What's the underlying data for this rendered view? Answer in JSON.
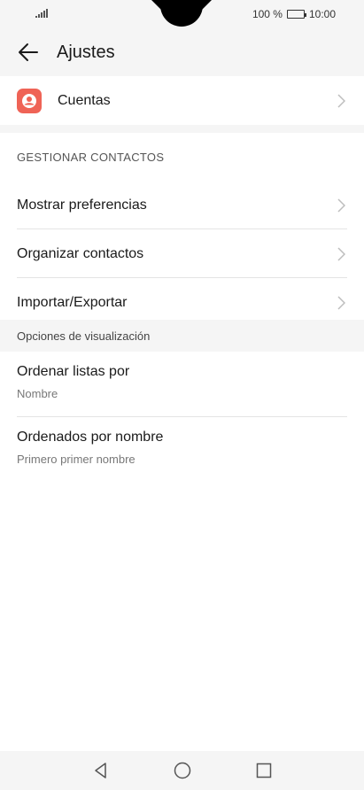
{
  "status_bar": {
    "battery": "100 %",
    "time": "10:00"
  },
  "header": {
    "title": "Ajustes"
  },
  "accounts": {
    "label": "Cuentas"
  },
  "manage_section": {
    "title": "GESTIONAR CONTACTOS",
    "items": [
      {
        "label": "Mostrar preferencias"
      },
      {
        "label": "Organizar contactos"
      },
      {
        "label": "Importar/Exportar"
      }
    ]
  },
  "display_section": {
    "title": "Opciones de visualización",
    "items": [
      {
        "label": "Ordenar listas por",
        "value": "Nombre"
      },
      {
        "label": "Ordenados por nombre",
        "value": "Primero primer nombre"
      }
    ]
  },
  "colors": {
    "accent": "#ef6356",
    "background": "#f5f5f5"
  }
}
